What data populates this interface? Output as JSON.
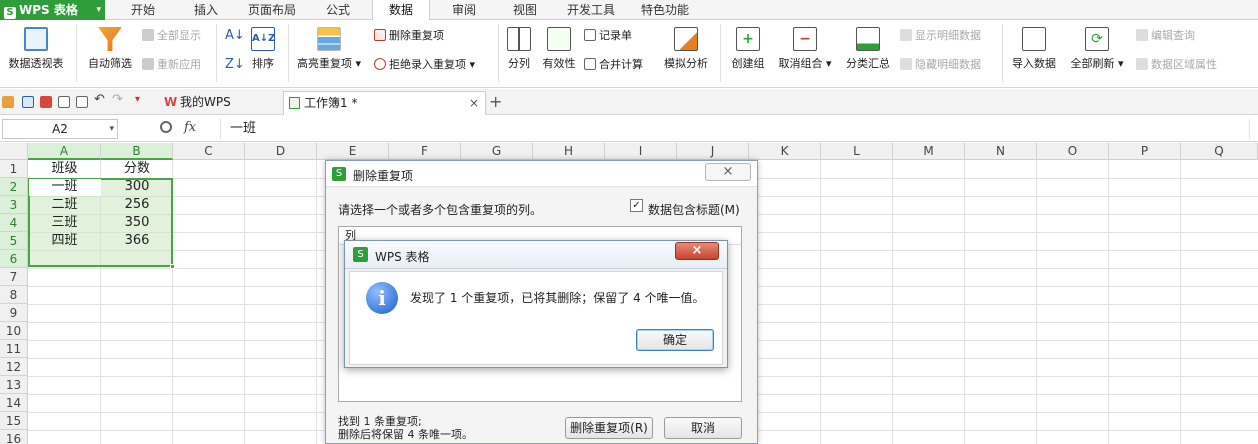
{
  "app": {
    "name": "WPS 表格",
    "logo": "S"
  },
  "menu_tabs": [
    "开始",
    "插入",
    "页面布局",
    "公式",
    "数据",
    "审阅",
    "视图",
    "开发工具",
    "特色功能"
  ],
  "active_menu_tab": "数据",
  "ribbon": {
    "pivot": "数据透视表",
    "autofilter": "自动筛选",
    "show_all": "全部显示",
    "reapply": "重新应用",
    "sort_az": "A↓Z",
    "sort": "排序",
    "highlight_dup": "高亮重复项",
    "remove_dup": "删除重复项",
    "reject_dup": "拒绝录入重复项",
    "split": "分列",
    "validity": "有效性",
    "record_list": "记录单",
    "merge_calc": "合并计算",
    "simulate": "模拟分析",
    "create_group": "创建组",
    "ungroup": "取消组合",
    "subtotal": "分类汇总",
    "show_detail": "显示明细数据",
    "hide_detail": "隐藏明细数据",
    "import": "导入数据",
    "refresh_all": "全部刷新",
    "edit_query": "编辑查询",
    "range_props": "数据区域属性"
  },
  "doc_tabs": {
    "home": "我的WPS",
    "workbook": "工作簿1 *",
    "close": "×",
    "new": "+"
  },
  "formula_bar": {
    "cell_ref": "A2",
    "fx": "fx",
    "content": "一班"
  },
  "columns": [
    "A",
    "B",
    "C",
    "D",
    "E",
    "F",
    "G",
    "H",
    "I",
    "J",
    "K",
    "L",
    "M",
    "N",
    "O",
    "P",
    "Q"
  ],
  "rows": [
    "1",
    "2",
    "3",
    "4",
    "5",
    "6",
    "7",
    "8",
    "9",
    "10",
    "11",
    "12",
    "13",
    "14",
    "15",
    "16"
  ],
  "cells": {
    "A1": "班级",
    "B1": "分数",
    "A2": "一班",
    "B2": "300",
    "A3": "二班",
    "B3": "256",
    "A4": "三班",
    "B4": "350",
    "A5": "四班",
    "B5": "366"
  },
  "dialog_remove_dup": {
    "title": "删除重复项",
    "prompt": "请选择一个或者多个包含重复项的列。",
    "header_checkbox": "数据包含标题(M)",
    "checked": "✓",
    "list_header": "列",
    "found_line1": "找到 1 条重复项;",
    "found_line2": "删除后将保留 4 条唯一项。",
    "btn_remove": "删除重复项(R)",
    "btn_cancel": "取消",
    "close": "×"
  },
  "dialog_message": {
    "title": "WPS 表格",
    "message": "发现了 1 个重复项，已将其删除；保留了 4 个唯一值。",
    "ok": "确定",
    "close": "×",
    "icon": "i"
  },
  "colors": {
    "brand": "#2f9e3a",
    "selection": "#4aa34a"
  }
}
